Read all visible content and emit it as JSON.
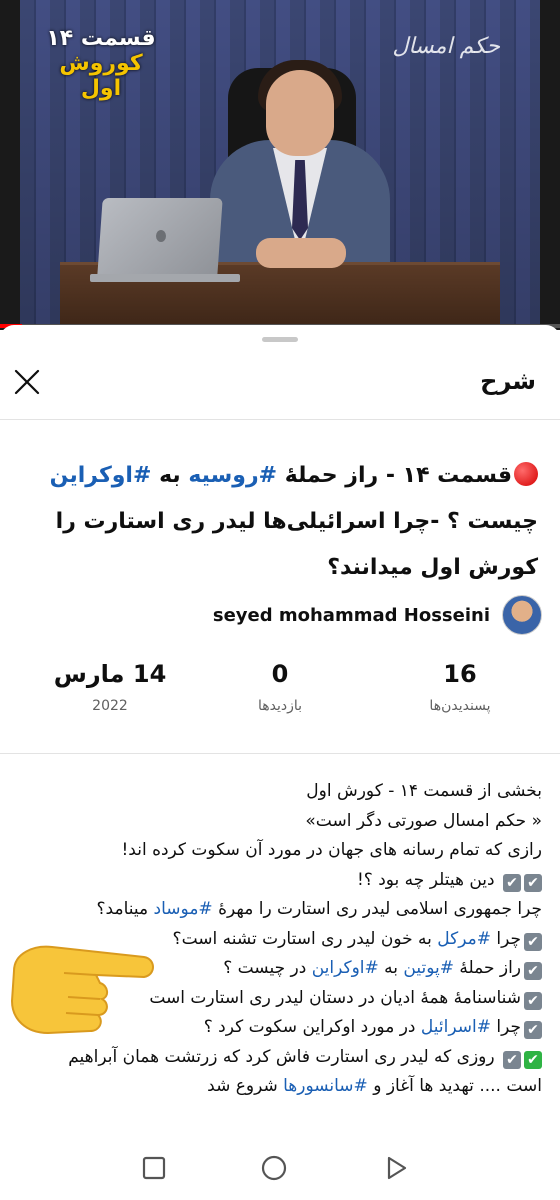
{
  "video": {
    "episode_line1": "قسمت ۱۴",
    "episode_line2": "کوروش اول",
    "watermark": "حکم امسال",
    "progress_fraction": 0.04
  },
  "sheet": {
    "title": "شرح",
    "close_icon": "close-icon"
  },
  "video_title": {
    "part1": "قسمت ۱۴ - راز حملهٔ ",
    "tag1": "#روسیه",
    "part2": " به ",
    "tag2": "#اوکراین",
    "part3": " چیست ؟ -چرا اسرائیلی‌ها لیدر ری استارت را کورش اول میدانند؟"
  },
  "channel": {
    "name": "seyed mohammad Hosseini",
    "avatar_icon": "channel-avatar"
  },
  "stats": {
    "likes_value": "16",
    "likes_label": "پسندیدن‌ها",
    "views_value": "0",
    "views_label": "بازدیدها",
    "date_value": "14 مارس",
    "date_label": "2022"
  },
  "description": {
    "line1": "بخشی از قسمت ۱۴ - کورش اول",
    "line2": "« حکم امسال صورتی دگر است»",
    "line3": "رازی که تمام رسانه های جهان در مورد آن سکوت کرده اند!",
    "line4": "دین هیتلر چه بود ؟!",
    "line5_a": "چرا جمهوری اسلامی لیدر ری استارت را مهرهٔ ",
    "line5_tag": "#موساد",
    "line5_b": " مینامد؟",
    "line6_a": "چرا ",
    "line6_tag": "#مرکل",
    "line6_b": " به خون لیدر ری استارت تشنه است؟",
    "line7_a": "راز حملهٔ ",
    "line7_tag1": "#پوتین",
    "line7_b": " به ",
    "line7_tag2": "#اوکراین",
    "line7_c": " در چیست ؟",
    "line8": "شناسنامهٔ همهٔ ادیان در دستان لیدر ری استارت است",
    "line9_a": "چرا ",
    "line9_tag": "#اسرائیل",
    "line9_b": " در مورد اوکراین سکوت کرد ؟",
    "line10": "روزی که لیدر ری استارت فاش کرد که زرتشت همان آبراهیم",
    "line11_a": "است .... تهدید ها آغاز و ",
    "line11_tag": "#سانسورها",
    "line11_b": " شروع شد",
    "check_glyph": "✔"
  },
  "navbar": {
    "icons": [
      "recents-icon",
      "home-icon",
      "back-icon"
    ]
  },
  "colors": {
    "hashtag": "#1a5fb4",
    "red_dot": "#d40000",
    "check_green": "#2fb344",
    "check_gray": "#7a8590"
  }
}
